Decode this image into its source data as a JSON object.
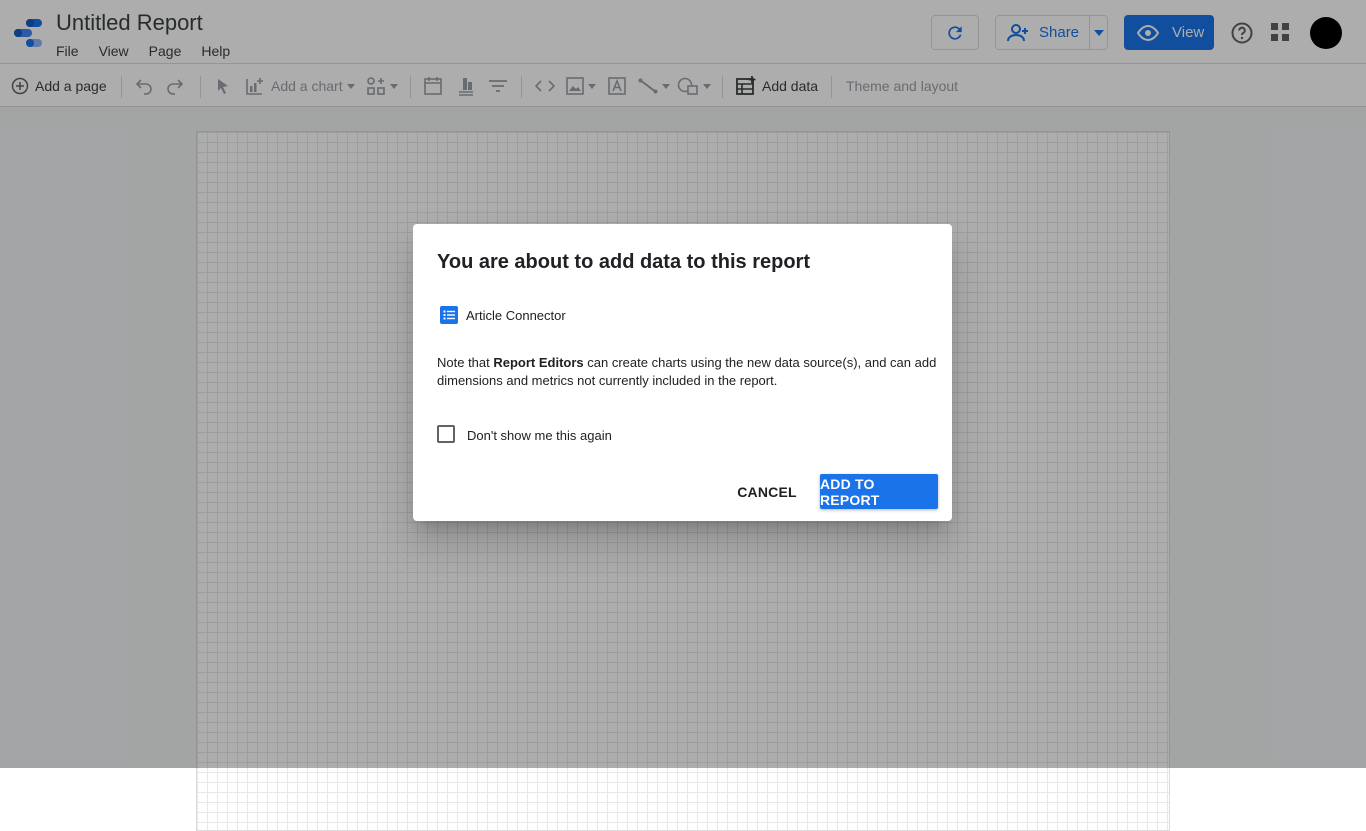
{
  "header": {
    "title": "Untitled Report",
    "menu": [
      "File",
      "View",
      "Page",
      "Help"
    ],
    "share_label": "Share",
    "view_label": "View"
  },
  "toolbar": {
    "add_page_label": "Add a page",
    "add_chart_label": "Add a chart",
    "add_data_label": "Add data",
    "theme_label": "Theme and layout"
  },
  "dialog": {
    "title": "You are about to add data to this report",
    "connector_name": "Article Connector",
    "note_prefix": "Note that ",
    "note_bold": "Report Editors",
    "note_suffix": " can create charts using the new data source(s), and can add dimensions and metrics not currently included in the report.",
    "checkbox_label": "Don't show me this again",
    "checkbox_checked": false,
    "cancel_label": "CANCEL",
    "add_label": "ADD TO REPORT"
  },
  "colors": {
    "accent": "#1a73e8",
    "scrim": "rgba(0,0,0,0.32)"
  }
}
